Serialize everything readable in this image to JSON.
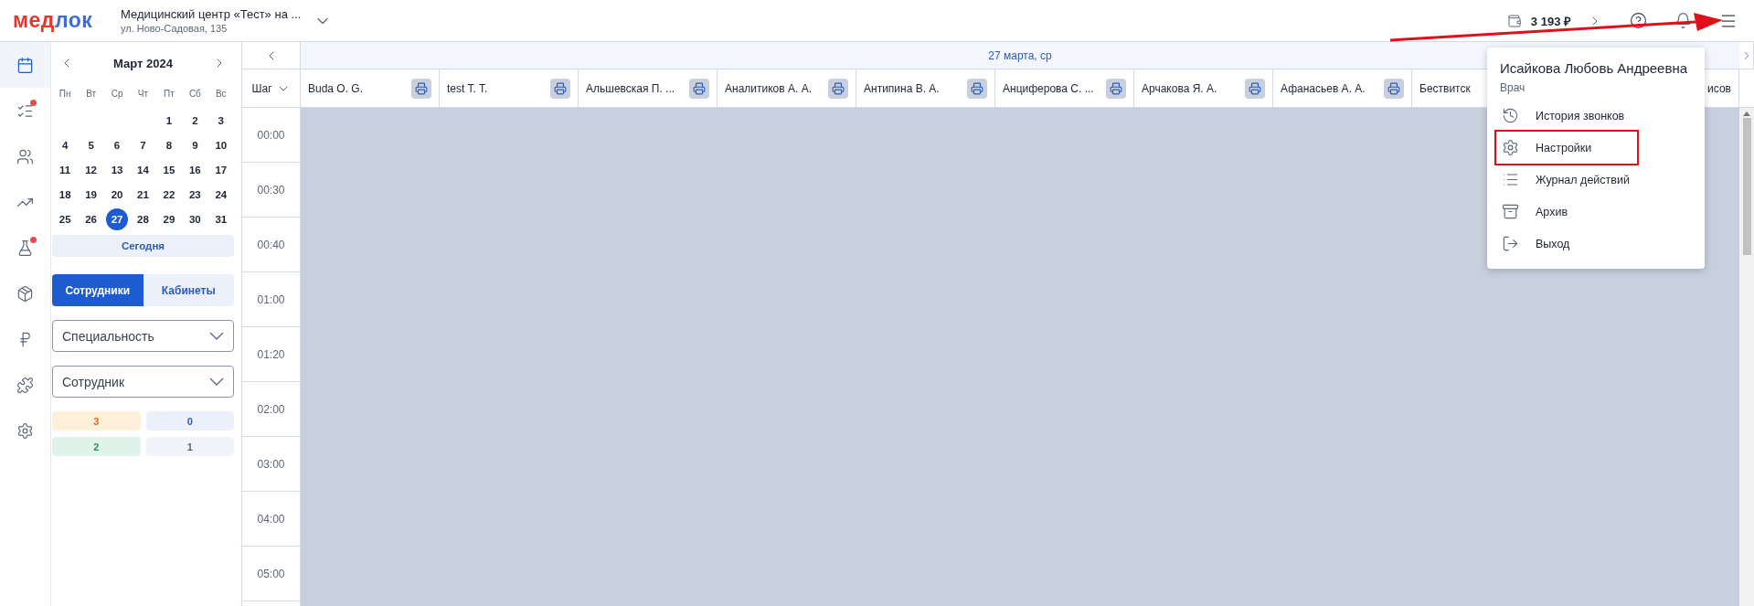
{
  "header": {
    "logo": {
      "first": "мед",
      "second": "лок"
    },
    "clinic": {
      "name": "Медицинский центр «Тест» на ...",
      "address": "ул. Ново-Садовая, 135"
    },
    "balance": "3 193 ₽"
  },
  "rail": [
    {
      "selected": true,
      "dot": false
    },
    {
      "selected": false,
      "dot": true
    },
    {
      "selected": false,
      "dot": false
    },
    {
      "selected": false,
      "dot": false
    },
    {
      "selected": false,
      "dot": true
    },
    {
      "selected": false,
      "dot": false
    },
    {
      "selected": false,
      "dot": false
    },
    {
      "selected": false,
      "dot": false
    },
    {
      "selected": false,
      "dot": false
    }
  ],
  "calendar": {
    "month": "Март 2024",
    "weekdays": [
      "Пн",
      "Вт",
      "Ср",
      "Чт",
      "Пт",
      "Сб",
      "Вс"
    ],
    "weeks": [
      [
        {
          "label": "1",
          "selected": false
        },
        {
          "label": "2",
          "selected": false
        },
        {
          "label": "3",
          "selected": false
        }
      ],
      [
        {
          "label": "4",
          "selected": false
        },
        {
          "label": "5",
          "selected": false
        },
        {
          "label": "6",
          "selected": false
        },
        {
          "label": "7",
          "selected": false
        },
        {
          "label": "8",
          "selected": false
        },
        {
          "label": "9",
          "selected": false
        },
        {
          "label": "10",
          "selected": false
        }
      ],
      [
        {
          "label": "11",
          "selected": false
        },
        {
          "label": "12",
          "selected": false
        },
        {
          "label": "13",
          "selected": false
        },
        {
          "label": "14",
          "selected": false
        },
        {
          "label": "15",
          "selected": false
        },
        {
          "label": "16",
          "selected": false
        },
        {
          "label": "17",
          "selected": false
        }
      ],
      [
        {
          "label": "18",
          "selected": false
        },
        {
          "label": "19",
          "selected": false
        },
        {
          "label": "20",
          "selected": false
        },
        {
          "label": "21",
          "selected": false
        },
        {
          "label": "22",
          "selected": false
        },
        {
          "label": "23",
          "selected": false
        },
        {
          "label": "24",
          "selected": false
        }
      ],
      [
        {
          "label": "25",
          "selected": false
        },
        {
          "label": "26",
          "selected": false
        },
        {
          "label": "27",
          "selected": true
        },
        {
          "label": "28",
          "selected": false
        },
        {
          "label": "29",
          "selected": false
        },
        {
          "label": "30",
          "selected": false
        },
        {
          "label": "31",
          "selected": false
        }
      ]
    ],
    "today_button": "Сегодня"
  },
  "view_tabs": [
    {
      "label": "Сотрудники",
      "selected": true
    },
    {
      "label": "Кабинеты",
      "selected": false
    }
  ],
  "filters": [
    {
      "placeholder": "Специальность"
    },
    {
      "placeholder": "Сотрудник"
    }
  ],
  "counters": [
    {
      "label": "3",
      "kind": "warning"
    },
    {
      "label": "0",
      "kind": "info"
    },
    {
      "label": "2",
      "kind": "success"
    },
    {
      "label": "1",
      "kind": "neutral"
    }
  ],
  "schedule": {
    "date": "27 марта, ср",
    "step_label": "Шаг",
    "columns": [
      {
        "name": "Buda O. G.",
        "printable": true
      },
      {
        "name": "test T. T.",
        "printable": true
      },
      {
        "name": "Альшевская П. ...",
        "printable": true
      },
      {
        "name": "Аналитиков А. А.",
        "printable": true
      },
      {
        "name": "Антипина В. А.",
        "printable": true
      },
      {
        "name": "Анциферова С. ...",
        "printable": true
      },
      {
        "name": "Арчакова Я. А.",
        "printable": true
      },
      {
        "name": "Афанасьев А. А.",
        "printable": true
      },
      {
        "name": "Бествитск",
        "printable": false
      },
      {
        "name": "исов",
        "printable": false
      }
    ],
    "times": [
      "00:00",
      "00:30",
      "00:40",
      "01:00",
      "01:20",
      "02:00",
      "03:00",
      "04:00",
      "05:00"
    ]
  },
  "user_menu": {
    "name": "Исайкова Любовь Андреевна",
    "role": "Врач",
    "items": [
      {
        "label": "История звонков",
        "highlighted": false
      },
      {
        "label": "Настройки",
        "highlighted": true
      },
      {
        "label": "Журнал действий",
        "highlighted": false
      },
      {
        "label": "Архив",
        "highlighted": false
      },
      {
        "label": "Выход",
        "highlighted": false
      }
    ]
  }
}
